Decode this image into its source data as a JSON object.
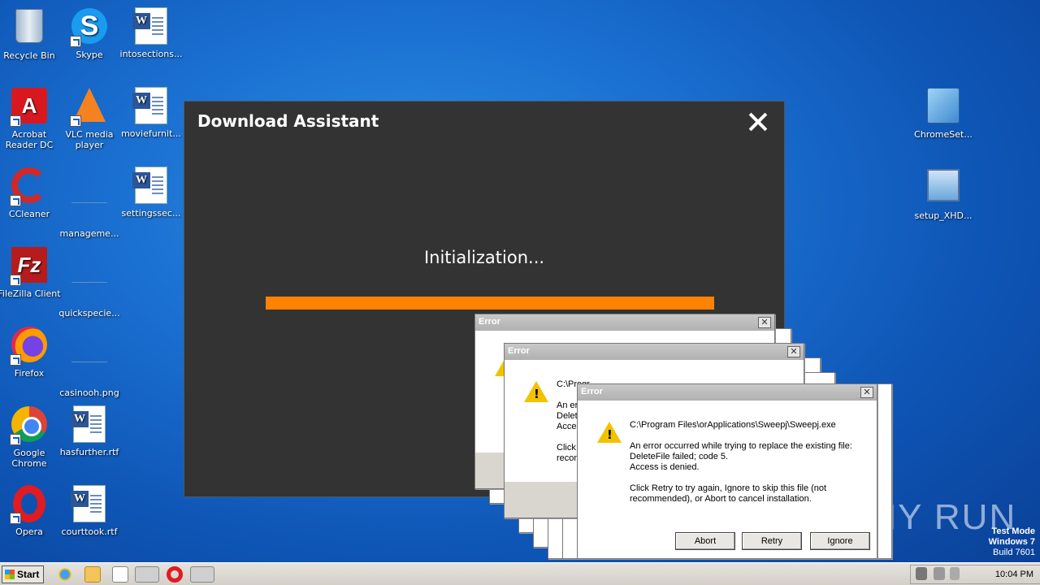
{
  "desktop": {
    "icons": [
      {
        "label": "Recycle Bin"
      },
      {
        "label": "Skype"
      },
      {
        "label": "intosections..."
      },
      {
        "label": "Acrobat Reader DC"
      },
      {
        "label": "VLC media player"
      },
      {
        "label": "moviefurnit..."
      },
      {
        "label": "CCleaner"
      },
      {
        "label": "manageme..."
      },
      {
        "label": "settingssec..."
      },
      {
        "label": "FileZilla Client"
      },
      {
        "label": "quickspecie..."
      },
      {
        "label": "Firefox"
      },
      {
        "label": "casinooh.png"
      },
      {
        "label": "Google Chrome"
      },
      {
        "label": "hasfurther.rtf"
      },
      {
        "label": "Opera"
      },
      {
        "label": "courttook.rtf"
      },
      {
        "label": "ChromeSet..."
      },
      {
        "label": "setup_XHD..."
      }
    ]
  },
  "download_assistant": {
    "title": "Download Assistant",
    "status": "Initialization...",
    "progress": 1.0,
    "progress_color": "#ff8200"
  },
  "error_back1": {
    "title": "Error"
  },
  "error_back2": {
    "title": "Error",
    "path": "C:\\Progr",
    "line1": "An err",
    "line2": "Delet",
    "line3": "Acces",
    "line4": "Click I",
    "line5": "recon"
  },
  "error_front": {
    "title": "Error",
    "path": "C:\\Program Files\\orApplications\\Sweepj\\Sweepj.exe",
    "line1": "An error occurred while trying to replace the existing file:",
    "line2": "DeleteFile failed; code 5.",
    "line3": "Access is denied.",
    "line4": "Click Retry to try again, Ignore to skip this file (not",
    "line5": "recommended), or Abort to cancel installation.",
    "buttons": {
      "abort": "Abort",
      "retry": "Retry",
      "ignore": "Ignore"
    }
  },
  "taskbar": {
    "start_label": "Start",
    "clock": "10:04 PM"
  },
  "watermark": {
    "line1": "Test Mode",
    "line2": "Windows 7",
    "line3": "Build 7601",
    "brand": "ANY RUN"
  }
}
